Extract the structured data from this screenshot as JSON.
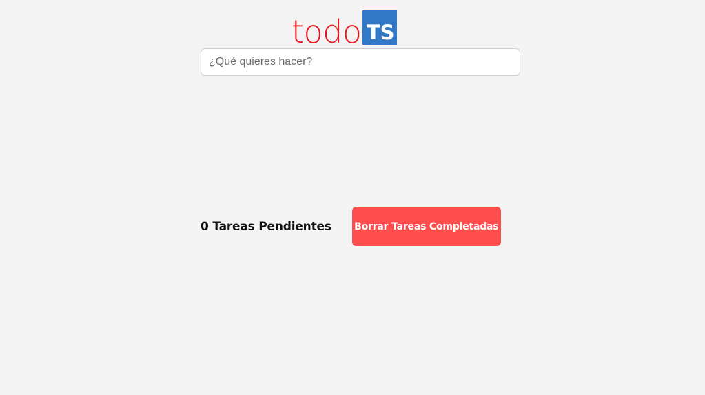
{
  "logo": {
    "text": "todo",
    "badge": "TS",
    "text_color": "#e8141b",
    "badge_color": "#3178c6"
  },
  "input": {
    "value": "",
    "placeholder": "¿Qué quieres hacer?"
  },
  "footer": {
    "pending_count": "0",
    "pending_label": "Tareas Pendientes",
    "clear_button_label": "Borrar Tareas Completadas",
    "button_color": "#ff4d4d"
  }
}
